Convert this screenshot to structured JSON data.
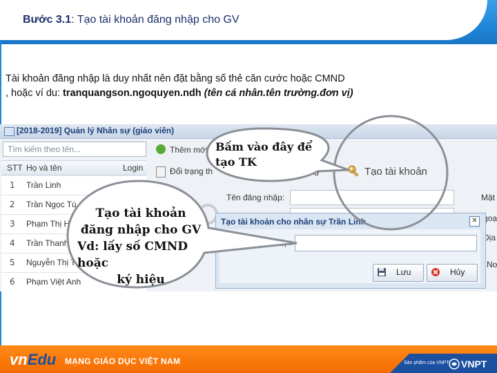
{
  "slide": {
    "title_step": "Bước 3.1",
    "title_rest": ": Tạo tài khoản đăng nhập cho GV",
    "desc_line1": "Tài khoản đăng nhập là duy nhất nên đặt bằng số thẻ căn cước hoặc CMND",
    "desc_line2_prefix": ", hoặc ví du: ",
    "desc_example": "tranquangson.ngoquyen.ndh",
    "desc_note": "(tên cá nhân.tên trường.đơn vị)"
  },
  "app": {
    "window_title": "[2018-2019] Quản lý Nhân sự (giáo viên)",
    "search_placeholder": "Tìm kiếm theo tên...",
    "columns": {
      "stt": "STT",
      "name": "Họ và tên",
      "login": "Login"
    },
    "rows": [
      {
        "num": "1",
        "name": "Trần Linh"
      },
      {
        "num": "2",
        "name": "Trần Ngọc Tú"
      },
      {
        "num": "3",
        "name": "Phạm Thị Hằ"
      },
      {
        "num": "4",
        "name": "Trần Thanh M"
      },
      {
        "num": "5",
        "name": "Nguyễn Thị Th"
      },
      {
        "num": "6",
        "name": "Phạm Việt Anh"
      }
    ],
    "toolbar": {
      "add_label": "Thêm mới",
      "status_label": "Đổi trạng th",
      "partial_1": "ân",
      "partial_2": "ư",
      "create_account": "Tạo tài khoản"
    },
    "form": {
      "username_label": "Tên đăng nhập:",
      "right_1": "Mật",
      "right_2": "goại",
      "right_3": "Địa",
      "right_4": "Nơ"
    },
    "dialog": {
      "title": "Tạo tài khoản cho nhân sự Trần Linh",
      "field_label_partial": "nhập:",
      "save": "Lưu",
      "cancel": "Hủy"
    }
  },
  "callouts": {
    "top": [
      "Bấm vào đây để",
      "tạo TK"
    ],
    "left": [
      "Tạo tài khoản",
      "đăng nhập cho GV",
      "Vd: lấy số CMND hoặc",
      "ký hiệu"
    ]
  },
  "footer": {
    "logo_vn": "vn",
    "logo_edu": "Edu",
    "network": "MẠNG GIÁO DỤC VIỆT NAM",
    "product_of": "Sản phẩm của VNPT",
    "vnpt": "VNPT"
  },
  "colors": {
    "header_blue": "#1f86d8",
    "title_text": "#1b2f6b",
    "footer_orange": "#f46c00",
    "footer_blue": "#1b4fa0"
  }
}
